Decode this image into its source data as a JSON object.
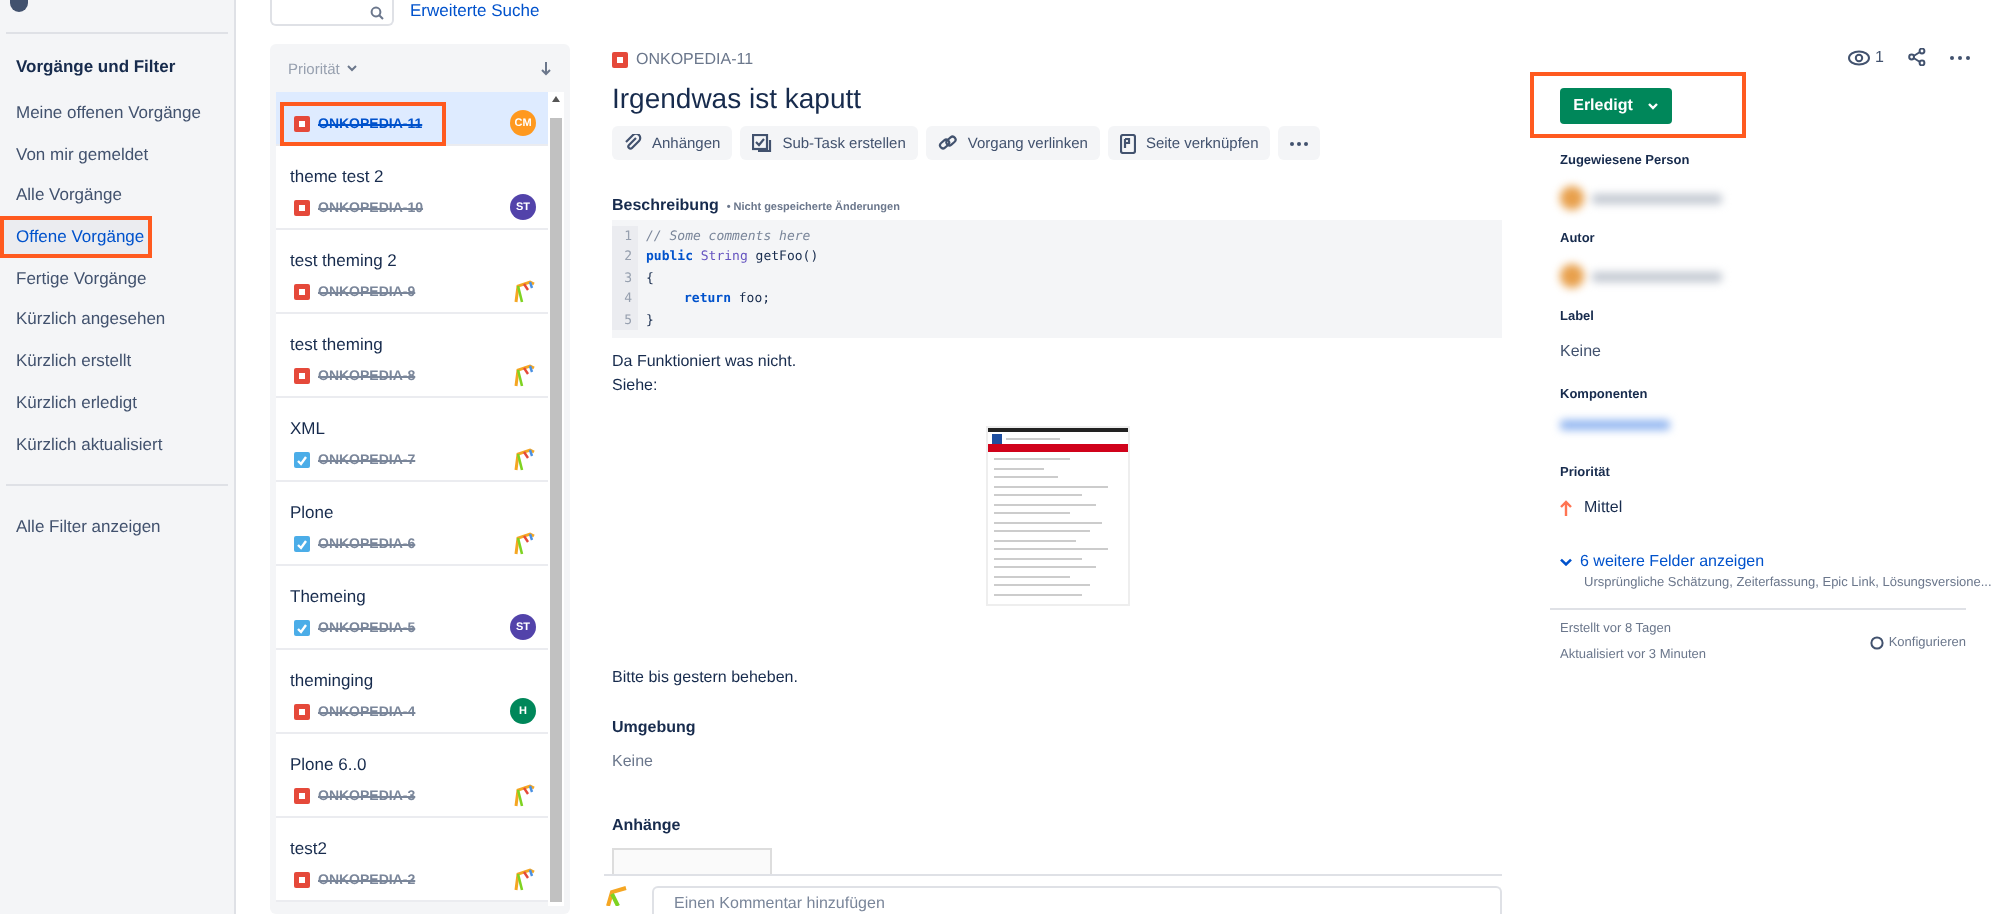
{
  "sidebar": {
    "heading": "Vorgänge und Filter",
    "items": [
      {
        "label": "Meine offenen Vorgänge",
        "selected": false,
        "highlighted": false
      },
      {
        "label": "Von mir gemeldet",
        "selected": false,
        "highlighted": false
      },
      {
        "label": "Alle Vorgänge",
        "selected": false,
        "highlighted": false
      },
      {
        "label": "Offene Vorgänge",
        "selected": true,
        "highlighted": true
      },
      {
        "label": "Fertige Vorgänge",
        "selected": false,
        "highlighted": false
      },
      {
        "label": "Kürzlich angesehen",
        "selected": false,
        "highlighted": false
      },
      {
        "label": "Kürzlich erstellt",
        "selected": false,
        "highlighted": false
      },
      {
        "label": "Kürzlich erledigt",
        "selected": false,
        "highlighted": false
      },
      {
        "label": "Kürzlich aktualisiert",
        "selected": false,
        "highlighted": false
      }
    ],
    "footer_link": "Alle Filter anzeigen"
  },
  "search": {
    "advanced_link": "Erweiterte Suche"
  },
  "issue_list": {
    "sort_label": "Priorität",
    "items": [
      {
        "key": "ONKOPEDIA-11",
        "kind": "bug",
        "selected": true,
        "highlighted": true,
        "avatar": {
          "kind": "initials",
          "text": "CM",
          "color": "#ff991f"
        }
      },
      {
        "title": "theme test 2",
        "key": "ONKOPEDIA-10",
        "kind": "bug",
        "selected": false,
        "highlighted": false,
        "avatar": {
          "kind": "initials",
          "text": "ST",
          "color": "#5243aa"
        }
      },
      {
        "title": "test theming 2",
        "key": "ONKOPEDIA-9",
        "kind": "bug",
        "selected": false,
        "highlighted": false,
        "avatar": {
          "kind": "image"
        }
      },
      {
        "title": "test theming",
        "key": "ONKOPEDIA-8",
        "kind": "bug",
        "selected": false,
        "highlighted": false,
        "avatar": {
          "kind": "image"
        }
      },
      {
        "title": "XML",
        "key": "ONKOPEDIA-7",
        "kind": "task",
        "selected": false,
        "highlighted": false,
        "avatar": {
          "kind": "image"
        }
      },
      {
        "title": "Plone",
        "key": "ONKOPEDIA-6",
        "kind": "task",
        "selected": false,
        "highlighted": false,
        "avatar": {
          "kind": "image"
        }
      },
      {
        "title": "Themeing",
        "key": "ONKOPEDIA-5",
        "kind": "task",
        "selected": false,
        "highlighted": false,
        "avatar": {
          "kind": "initials",
          "text": "ST",
          "color": "#5243aa"
        }
      },
      {
        "title": "theminging",
        "key": "ONKOPEDIA-4",
        "kind": "bug",
        "selected": false,
        "highlighted": false,
        "avatar": {
          "kind": "initials",
          "text": "H",
          "color": "#00875a"
        }
      },
      {
        "title": "Plone 6..0",
        "key": "ONKOPEDIA-3",
        "kind": "bug",
        "selected": false,
        "highlighted": false,
        "avatar": {
          "kind": "image"
        }
      },
      {
        "title": "test2",
        "key": "ONKOPEDIA-2",
        "kind": "bug",
        "selected": false,
        "highlighted": false,
        "avatar": {
          "kind": "image"
        }
      }
    ]
  },
  "issue": {
    "key": "ONKOPEDIA-11",
    "kind": "bug",
    "title": "Irgendwas ist kaputt",
    "actions": [
      {
        "kind": "attach",
        "label": "Anhängen"
      },
      {
        "kind": "subtask",
        "label": "Sub-Task erstellen"
      },
      {
        "kind": "link",
        "label": "Vorgang verlinken"
      },
      {
        "kind": "page",
        "label": "Seite verknüpfen"
      },
      {
        "kind": "more"
      }
    ],
    "description_label": "Beschreibung",
    "unsaved_note": "• Nicht gespeicherte Änderungen",
    "code": [
      {
        "number": "1",
        "tokens": [
          {
            "kind": "comment",
            "text": "// Some comments here"
          }
        ]
      },
      {
        "number": "2",
        "tokens": [
          {
            "kind": "keyword",
            "text": "public"
          },
          {
            "kind": "type",
            "text": " String"
          },
          {
            "kind": "plain",
            "text": " getFoo()"
          }
        ]
      },
      {
        "number": "3",
        "tokens": [
          {
            "kind": "plain",
            "text": "{"
          }
        ]
      },
      {
        "number": "4",
        "indented": true,
        "tokens": [
          {
            "kind": "keyword",
            "text": "return"
          },
          {
            "kind": "plain",
            "text": " foo;"
          }
        ]
      },
      {
        "number": "5",
        "tokens": [
          {
            "kind": "plain",
            "text": "}"
          }
        ]
      }
    ],
    "paragraphs_before": [
      "Da Funktioniert was nicht.",
      "Siehe:"
    ],
    "paragraph_after": "Bitte bis gestern beheben.",
    "environment_label": "Umgebung",
    "environment_value": "Keine",
    "attachments_label": "Anhänge",
    "comment_placeholder": "Einen Kommentar hinzufügen"
  },
  "details": {
    "watchers": "1",
    "status": "Erledigt",
    "status_highlighted": true,
    "fields": [
      {
        "kind": "person",
        "label": "Zugewiesene Person"
      },
      {
        "kind": "person",
        "label": "Autor"
      },
      {
        "kind": "text",
        "label": "Label",
        "value": "Keine"
      },
      {
        "kind": "blurred",
        "label": "Komponenten"
      },
      {
        "kind": "priority",
        "label": "Priorität",
        "value": "Mittel"
      }
    ],
    "more_fields_link": "6 weitere Felder anzeigen",
    "more_fields_hint": "Ursprüngliche Schätzung, Zeiterfassung, Epic Link, Lösungsversione...",
    "created": "Erstellt vor 8 Tagen",
    "updated": "Aktualisiert vor 3 Minuten",
    "configure": "Konfigurieren"
  }
}
